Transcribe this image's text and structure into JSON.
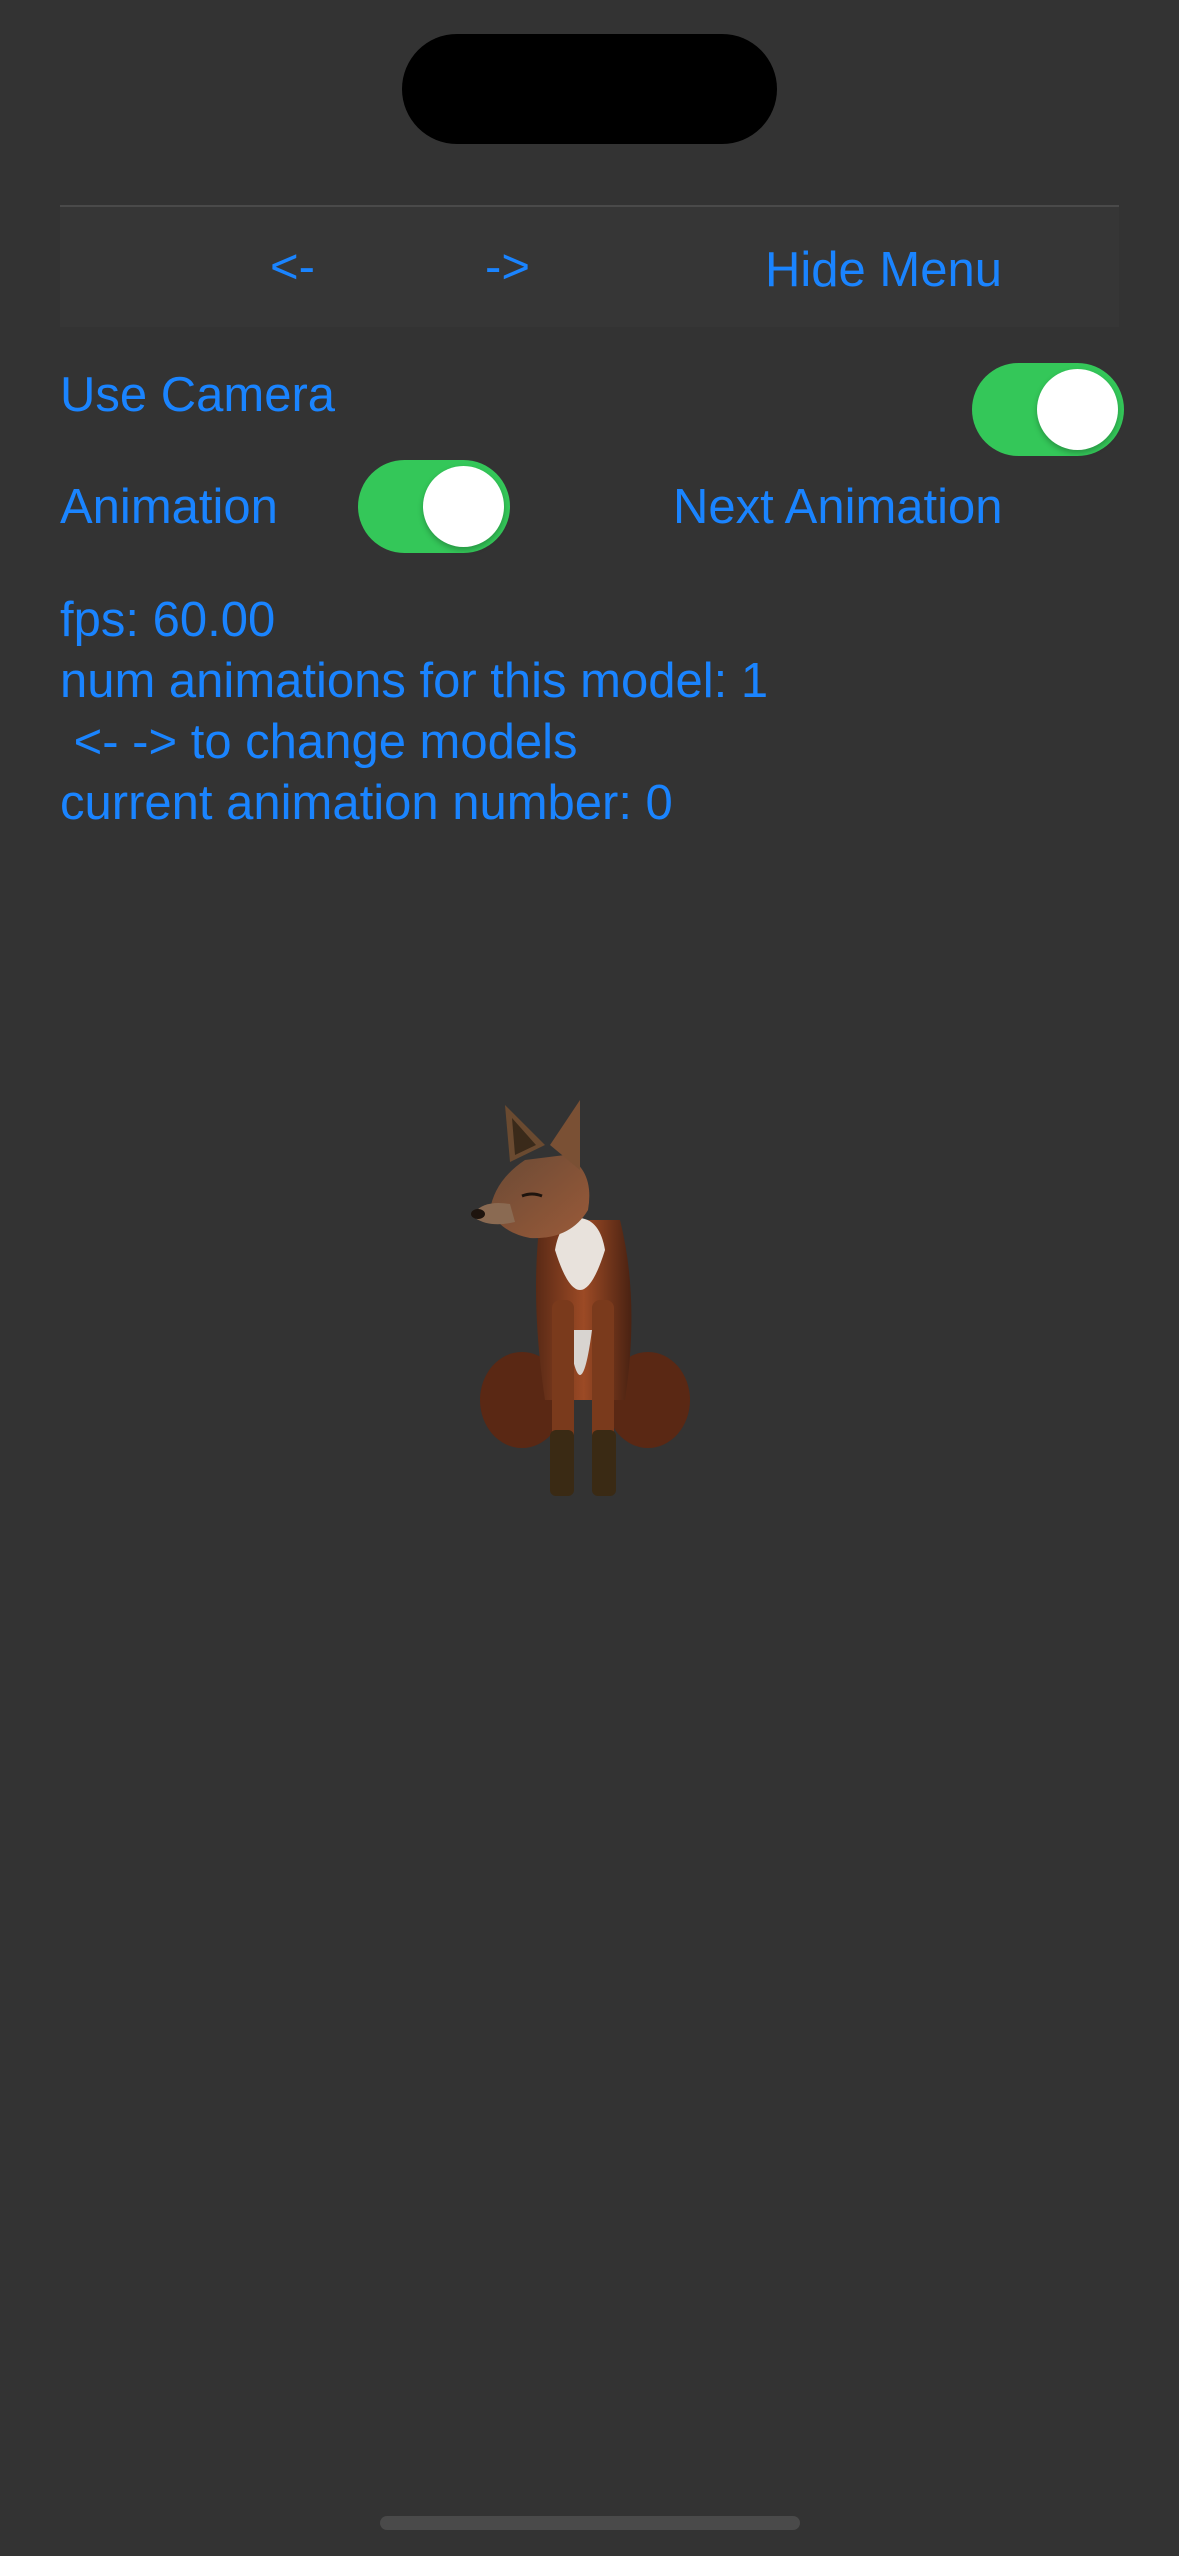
{
  "toolbar": {
    "prev_label": "<-",
    "next_label": "->",
    "hide_menu_label": "Hide Menu"
  },
  "controls": {
    "use_camera_label": "Use Camera",
    "use_camera_on": true,
    "animation_label": "Animation",
    "animation_on": true,
    "next_animation_label": "Next Animation"
  },
  "info": {
    "fps": "fps: 60.00",
    "num_animations": "num animations for this model: 1",
    "change_models_hint": " <- -> to change models",
    "current_animation": "current animation number: 0"
  },
  "scene": {
    "model_icon": "fox-model"
  },
  "colors": {
    "background": "#333333",
    "accent": "#1a84ff",
    "toggle_on": "#34c759"
  }
}
